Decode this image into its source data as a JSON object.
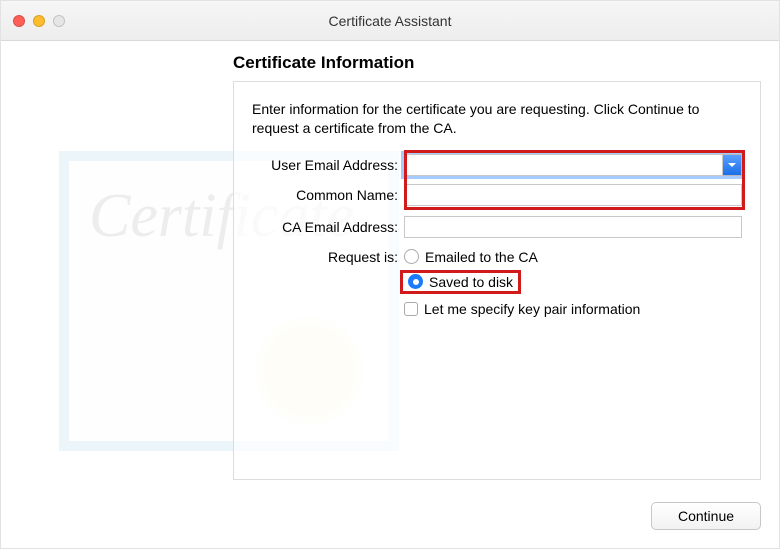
{
  "window": {
    "title": "Certificate Assistant"
  },
  "section_title": "Certificate Information",
  "description": "Enter information for the certificate you are requesting. Click Continue to request a certificate from the CA.",
  "fields": {
    "user_email": {
      "label": "User Email Address:",
      "value": ""
    },
    "common_name": {
      "label": "Common Name:",
      "value": ""
    },
    "ca_email": {
      "label": "CA Email Address:",
      "value": ""
    }
  },
  "request": {
    "label": "Request is:",
    "options": {
      "emailed": "Emailed to the CA",
      "saved": "Saved to disk"
    },
    "selected": "saved"
  },
  "keypair": {
    "label": "Let me specify key pair information",
    "checked": false
  },
  "buttons": {
    "continue": "Continue"
  },
  "decor": {
    "word": "Certificate"
  }
}
